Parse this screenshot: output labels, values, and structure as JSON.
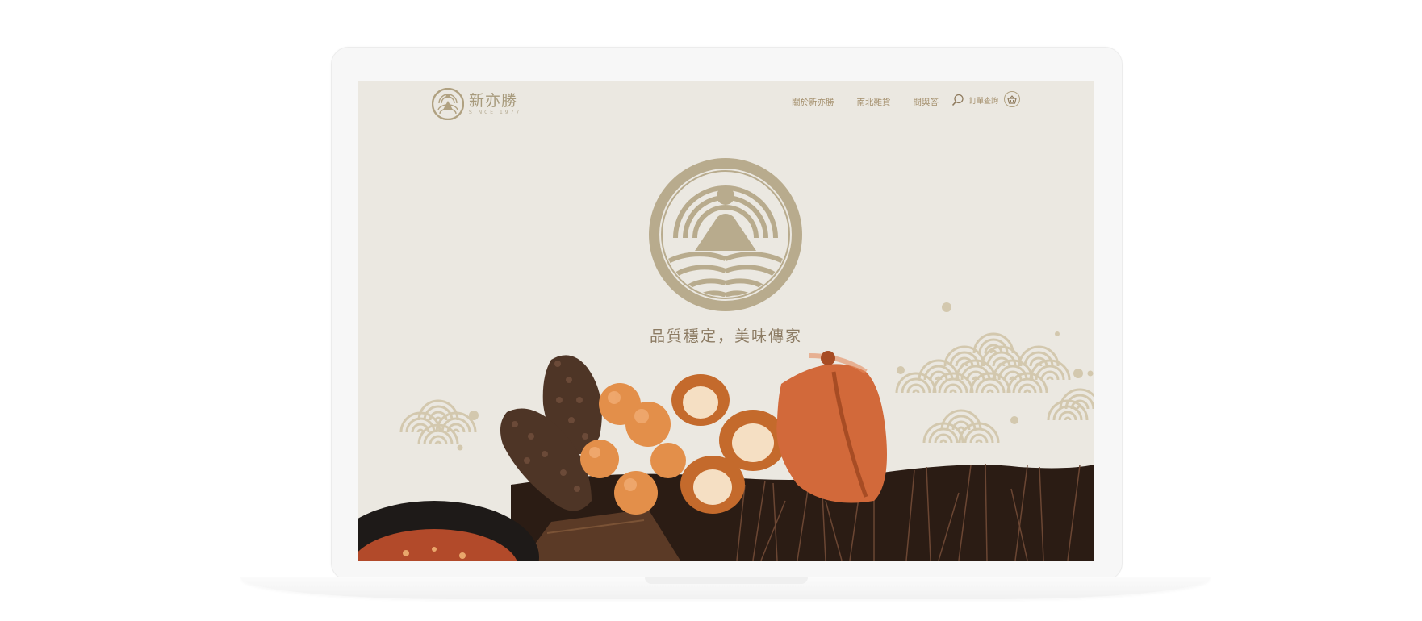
{
  "brand": {
    "name": "新亦勝",
    "since": "SINCE 1977"
  },
  "nav": {
    "items": [
      {
        "label": "關於新亦勝"
      },
      {
        "label": "南北雜貨"
      },
      {
        "label": "問與答"
      }
    ],
    "order_label": "訂單查詢"
  },
  "hero": {
    "tagline": "品質穩定，美味傳家"
  },
  "colors": {
    "gold": "#b0a181",
    "background": "#ebe8e1",
    "accent_orange": "#d2693a"
  },
  "icons": {
    "search": "search-icon",
    "cart": "basket-icon"
  }
}
